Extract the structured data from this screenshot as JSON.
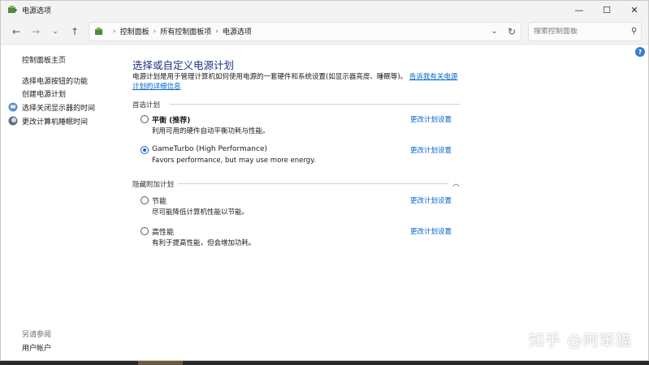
{
  "window": {
    "title": "电源选项",
    "icons": {
      "app": "power-options-icon",
      "minimize": "minimize-icon",
      "maximize": "maximize-icon",
      "close": "close-icon"
    }
  },
  "nav": {
    "breadcrumbs": [
      "控制面板",
      "所有控制面板项",
      "电源选项"
    ],
    "search_placeholder": "搜索控制面板"
  },
  "sidebar": {
    "home": "控制面板主页",
    "links": [
      {
        "label": "选择电源按钮的功能",
        "icon": ""
      },
      {
        "label": "创建电源计划",
        "icon": ""
      },
      {
        "label": "选择关闭显示器的时间",
        "icon": "monitor-icon"
      },
      {
        "label": "更改计算机睡眠时间",
        "icon": "moon-icon"
      }
    ],
    "see_also_heading": "另请参阅",
    "see_also_links": [
      "用户帐户"
    ]
  },
  "main": {
    "heading": "选择或自定义电源计划",
    "description": "电源计划是用于管理计算机如何使用电源的一套硬件和系统设置(如显示器亮度、睡眠等)。",
    "description_link": "告诉我有关电源计划的详细信息",
    "preferred_group": "首选计划",
    "hidden_group": "隐藏附加计划",
    "change_link": "更改计划设置",
    "plans": [
      {
        "name": "平衡 (推荐)",
        "desc": "利用可用的硬件自动平衡功耗与性能。",
        "selected": false,
        "bold": true
      },
      {
        "name": "GameTurbo (High Performance)",
        "desc": "Favors performance, but may use more energy.",
        "selected": true,
        "bold": false
      },
      {
        "name": "节能",
        "desc": "尽可能降低计算机性能以节能。",
        "selected": false,
        "bold": false
      },
      {
        "name": "高性能",
        "desc": "有利于提高性能，但会增加功耗。",
        "selected": false,
        "bold": false
      }
    ]
  },
  "help_label": "?",
  "watermark": "知乎 @阿笨猫",
  "colors": {
    "heading": "#1e3287",
    "link": "#0066cc",
    "radio_selected": "#1b5fc1"
  }
}
